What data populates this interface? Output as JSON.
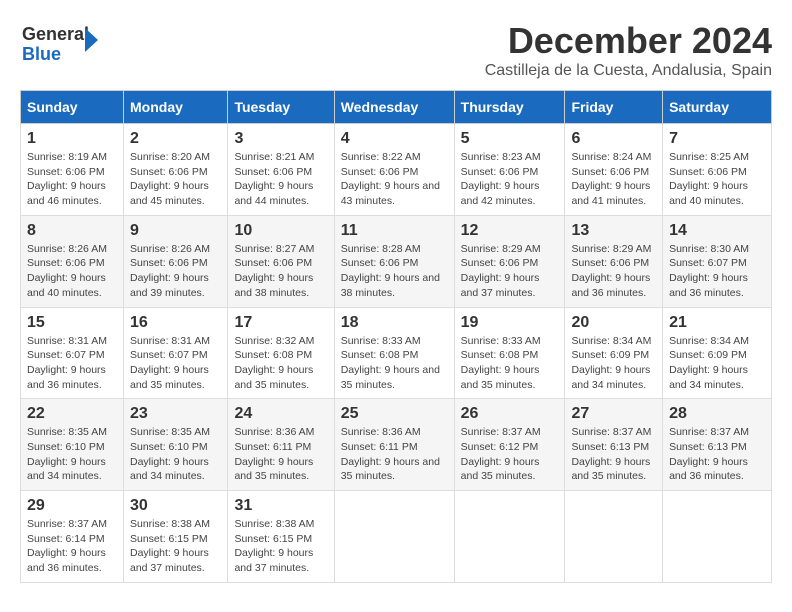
{
  "logo": {
    "text_general": "General",
    "text_blue": "Blue"
  },
  "title": "December 2024",
  "subtitle": "Castilleja de la Cuesta, Andalusia, Spain",
  "header": {
    "days": [
      "Sunday",
      "Monday",
      "Tuesday",
      "Wednesday",
      "Thursday",
      "Friday",
      "Saturday"
    ]
  },
  "weeks": [
    {
      "cells": [
        {
          "day": "1",
          "sunrise": "Sunrise: 8:19 AM",
          "sunset": "Sunset: 6:06 PM",
          "daylight": "Daylight: 9 hours and 46 minutes."
        },
        {
          "day": "2",
          "sunrise": "Sunrise: 8:20 AM",
          "sunset": "Sunset: 6:06 PM",
          "daylight": "Daylight: 9 hours and 45 minutes."
        },
        {
          "day": "3",
          "sunrise": "Sunrise: 8:21 AM",
          "sunset": "Sunset: 6:06 PM",
          "daylight": "Daylight: 9 hours and 44 minutes."
        },
        {
          "day": "4",
          "sunrise": "Sunrise: 8:22 AM",
          "sunset": "Sunset: 6:06 PM",
          "daylight": "Daylight: 9 hours and 43 minutes."
        },
        {
          "day": "5",
          "sunrise": "Sunrise: 8:23 AM",
          "sunset": "Sunset: 6:06 PM",
          "daylight": "Daylight: 9 hours and 42 minutes."
        },
        {
          "day": "6",
          "sunrise": "Sunrise: 8:24 AM",
          "sunset": "Sunset: 6:06 PM",
          "daylight": "Daylight: 9 hours and 41 minutes."
        },
        {
          "day": "7",
          "sunrise": "Sunrise: 8:25 AM",
          "sunset": "Sunset: 6:06 PM",
          "daylight": "Daylight: 9 hours and 40 minutes."
        }
      ]
    },
    {
      "cells": [
        {
          "day": "8",
          "sunrise": "Sunrise: 8:26 AM",
          "sunset": "Sunset: 6:06 PM",
          "daylight": "Daylight: 9 hours and 40 minutes."
        },
        {
          "day": "9",
          "sunrise": "Sunrise: 8:26 AM",
          "sunset": "Sunset: 6:06 PM",
          "daylight": "Daylight: 9 hours and 39 minutes."
        },
        {
          "day": "10",
          "sunrise": "Sunrise: 8:27 AM",
          "sunset": "Sunset: 6:06 PM",
          "daylight": "Daylight: 9 hours and 38 minutes."
        },
        {
          "day": "11",
          "sunrise": "Sunrise: 8:28 AM",
          "sunset": "Sunset: 6:06 PM",
          "daylight": "Daylight: 9 hours and 38 minutes."
        },
        {
          "day": "12",
          "sunrise": "Sunrise: 8:29 AM",
          "sunset": "Sunset: 6:06 PM",
          "daylight": "Daylight: 9 hours and 37 minutes."
        },
        {
          "day": "13",
          "sunrise": "Sunrise: 8:29 AM",
          "sunset": "Sunset: 6:06 PM",
          "daylight": "Daylight: 9 hours and 36 minutes."
        },
        {
          "day": "14",
          "sunrise": "Sunrise: 8:30 AM",
          "sunset": "Sunset: 6:07 PM",
          "daylight": "Daylight: 9 hours and 36 minutes."
        }
      ]
    },
    {
      "cells": [
        {
          "day": "15",
          "sunrise": "Sunrise: 8:31 AM",
          "sunset": "Sunset: 6:07 PM",
          "daylight": "Daylight: 9 hours and 36 minutes."
        },
        {
          "day": "16",
          "sunrise": "Sunrise: 8:31 AM",
          "sunset": "Sunset: 6:07 PM",
          "daylight": "Daylight: 9 hours and 35 minutes."
        },
        {
          "day": "17",
          "sunrise": "Sunrise: 8:32 AM",
          "sunset": "Sunset: 6:08 PM",
          "daylight": "Daylight: 9 hours and 35 minutes."
        },
        {
          "day": "18",
          "sunrise": "Sunrise: 8:33 AM",
          "sunset": "Sunset: 6:08 PM",
          "daylight": "Daylight: 9 hours and 35 minutes."
        },
        {
          "day": "19",
          "sunrise": "Sunrise: 8:33 AM",
          "sunset": "Sunset: 6:08 PM",
          "daylight": "Daylight: 9 hours and 35 minutes."
        },
        {
          "day": "20",
          "sunrise": "Sunrise: 8:34 AM",
          "sunset": "Sunset: 6:09 PM",
          "daylight": "Daylight: 9 hours and 34 minutes."
        },
        {
          "day": "21",
          "sunrise": "Sunrise: 8:34 AM",
          "sunset": "Sunset: 6:09 PM",
          "daylight": "Daylight: 9 hours and 34 minutes."
        }
      ]
    },
    {
      "cells": [
        {
          "day": "22",
          "sunrise": "Sunrise: 8:35 AM",
          "sunset": "Sunset: 6:10 PM",
          "daylight": "Daylight: 9 hours and 34 minutes."
        },
        {
          "day": "23",
          "sunrise": "Sunrise: 8:35 AM",
          "sunset": "Sunset: 6:10 PM",
          "daylight": "Daylight: 9 hours and 34 minutes."
        },
        {
          "day": "24",
          "sunrise": "Sunrise: 8:36 AM",
          "sunset": "Sunset: 6:11 PM",
          "daylight": "Daylight: 9 hours and 35 minutes."
        },
        {
          "day": "25",
          "sunrise": "Sunrise: 8:36 AM",
          "sunset": "Sunset: 6:11 PM",
          "daylight": "Daylight: 9 hours and 35 minutes."
        },
        {
          "day": "26",
          "sunrise": "Sunrise: 8:37 AM",
          "sunset": "Sunset: 6:12 PM",
          "daylight": "Daylight: 9 hours and 35 minutes."
        },
        {
          "day": "27",
          "sunrise": "Sunrise: 8:37 AM",
          "sunset": "Sunset: 6:13 PM",
          "daylight": "Daylight: 9 hours and 35 minutes."
        },
        {
          "day": "28",
          "sunrise": "Sunrise: 8:37 AM",
          "sunset": "Sunset: 6:13 PM",
          "daylight": "Daylight: 9 hours and 36 minutes."
        }
      ]
    },
    {
      "cells": [
        {
          "day": "29",
          "sunrise": "Sunrise: 8:37 AM",
          "sunset": "Sunset: 6:14 PM",
          "daylight": "Daylight: 9 hours and 36 minutes."
        },
        {
          "day": "30",
          "sunrise": "Sunrise: 8:38 AM",
          "sunset": "Sunset: 6:15 PM",
          "daylight": "Daylight: 9 hours and 37 minutes."
        },
        {
          "day": "31",
          "sunrise": "Sunrise: 8:38 AM",
          "sunset": "Sunset: 6:15 PM",
          "daylight": "Daylight: 9 hours and 37 minutes."
        },
        {
          "day": "",
          "sunrise": "",
          "sunset": "",
          "daylight": ""
        },
        {
          "day": "",
          "sunrise": "",
          "sunset": "",
          "daylight": ""
        },
        {
          "day": "",
          "sunrise": "",
          "sunset": "",
          "daylight": ""
        },
        {
          "day": "",
          "sunrise": "",
          "sunset": "",
          "daylight": ""
        }
      ]
    }
  ]
}
